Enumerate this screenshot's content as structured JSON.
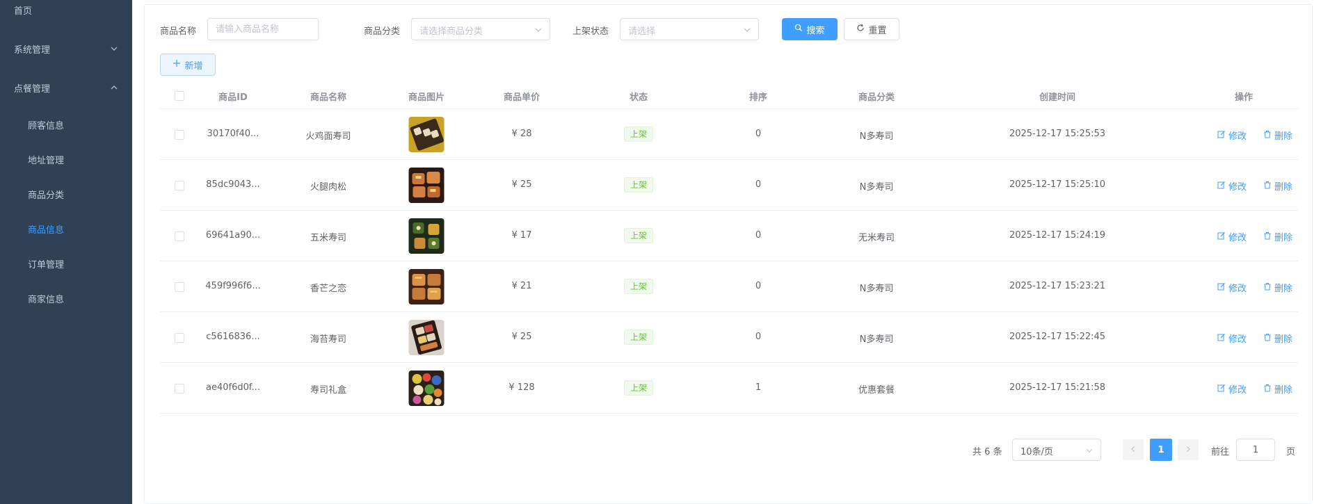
{
  "sidebar": {
    "items": [
      {
        "label": "首页"
      },
      {
        "label": "系统管理"
      },
      {
        "label": "点餐管理"
      },
      {
        "label": "顾客信息"
      },
      {
        "label": "地址管理"
      },
      {
        "label": "商品分类"
      },
      {
        "label": "商品信息"
      },
      {
        "label": "订单管理"
      },
      {
        "label": "商家信息"
      }
    ]
  },
  "search": {
    "name_label": "商品名称",
    "name_placeholder": "请输入商品名称",
    "category_label": "商品分类",
    "category_placeholder": "请选择商品分类",
    "status_label": "上架状态",
    "status_placeholder": "请选择",
    "search_button": "搜索",
    "reset_button": "重置"
  },
  "toolbar": {
    "add_button": "新增"
  },
  "table": {
    "headers": [
      "商品ID",
      "商品名称",
      "商品图片",
      "商品单价",
      "状态",
      "排序",
      "商品分类",
      "创建时间",
      "操作"
    ],
    "rows": [
      {
        "id": "30170f40...",
        "name": "火鸡面寿司",
        "price": "¥ 28",
        "status": "上架",
        "sort": "0",
        "category": "N多寿司",
        "created": "2025-12-17 15:25:53"
      },
      {
        "id": "85dc9043...",
        "name": "火腿肉松",
        "price": "¥ 25",
        "status": "上架",
        "sort": "0",
        "category": "N多寿司",
        "created": "2025-12-17 15:25:10"
      },
      {
        "id": "69641a90...",
        "name": "五米寿司",
        "price": "¥ 17",
        "status": "上架",
        "sort": "0",
        "category": "无米寿司",
        "created": "2025-12-17 15:24:19"
      },
      {
        "id": "459f996f6...",
        "name": "香芒之恋",
        "price": "¥ 21",
        "status": "上架",
        "sort": "0",
        "category": "N多寿司",
        "created": "2025-12-17 15:23:21"
      },
      {
        "id": "c5616836...",
        "name": "海苔寿司",
        "price": "¥ 25",
        "status": "上架",
        "sort": "0",
        "category": "N多寿司",
        "created": "2025-12-17 15:22:45"
      },
      {
        "id": "ae40f6d0f...",
        "name": "寿司礼盒",
        "price": "¥ 128",
        "status": "上架",
        "sort": "1",
        "category": "优惠套餐",
        "created": "2025-12-17 15:21:58"
      }
    ],
    "edit_label": "修改",
    "delete_label": "删除"
  },
  "pagination": {
    "total_text": "共 6 条",
    "page_size": "10条/页",
    "current_page": "1",
    "goto_label": "前往",
    "goto_value": "1",
    "page_suffix": "页"
  },
  "colors": {
    "sidebar_bg": "#304156",
    "accent": "#409eff",
    "success": "#67c23a"
  }
}
